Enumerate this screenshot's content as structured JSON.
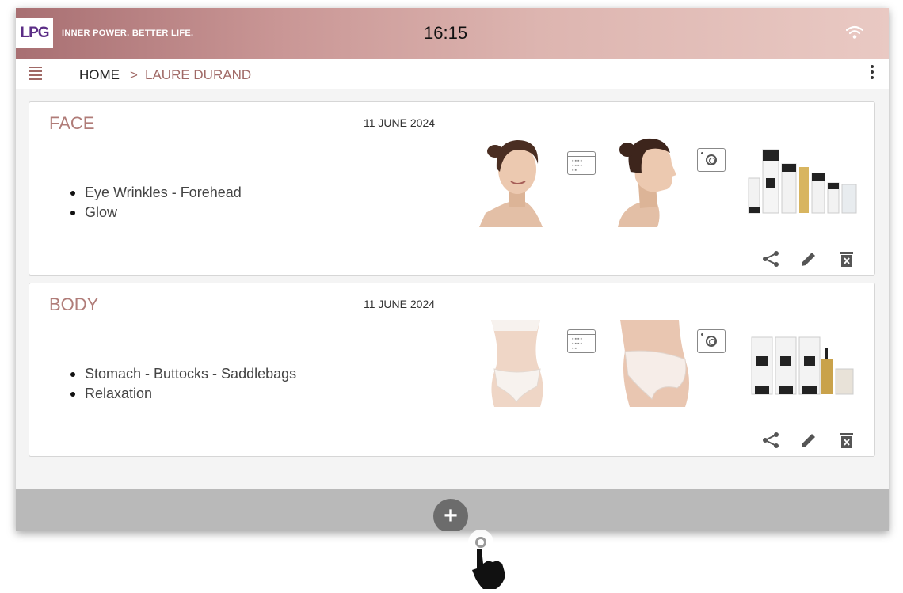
{
  "header": {
    "logo_text": "LPG",
    "tagline": "INNER POWER. BETTER LIFE.",
    "time": "16:15",
    "wifi_icon": "wifi-icon"
  },
  "nav": {
    "menu_icon": "menu-icon",
    "breadcrumb_home": "HOME",
    "breadcrumb_sep": ">",
    "breadcrumb_current": "LAURE DURAND",
    "more_icon": "more-vert-icon"
  },
  "cards": [
    {
      "title": "FACE",
      "date": "11 JUNE 2024",
      "items": [
        "Eye Wrinkles - Forehead",
        "Glow"
      ],
      "icons": [
        "calendar-icon",
        "camera-icon",
        "share-icon",
        "edit-icon",
        "delete-icon"
      ]
    },
    {
      "title": "BODY",
      "date": "11 JUNE 2024",
      "items": [
        "Stomach - Buttocks - Saddlebags",
        "Relaxation"
      ],
      "icons": [
        "calendar-icon",
        "camera-icon",
        "share-icon",
        "edit-icon",
        "delete-icon"
      ]
    }
  ],
  "footer": {
    "add_button_symbol": "+",
    "add_icon": "add-icon"
  },
  "colors": {
    "accent": "#b07c78",
    "header_start": "#a86f72",
    "header_end": "#e9c9c3",
    "footer_bar": "#b9b9b9",
    "add_button": "#6c6c6c"
  }
}
